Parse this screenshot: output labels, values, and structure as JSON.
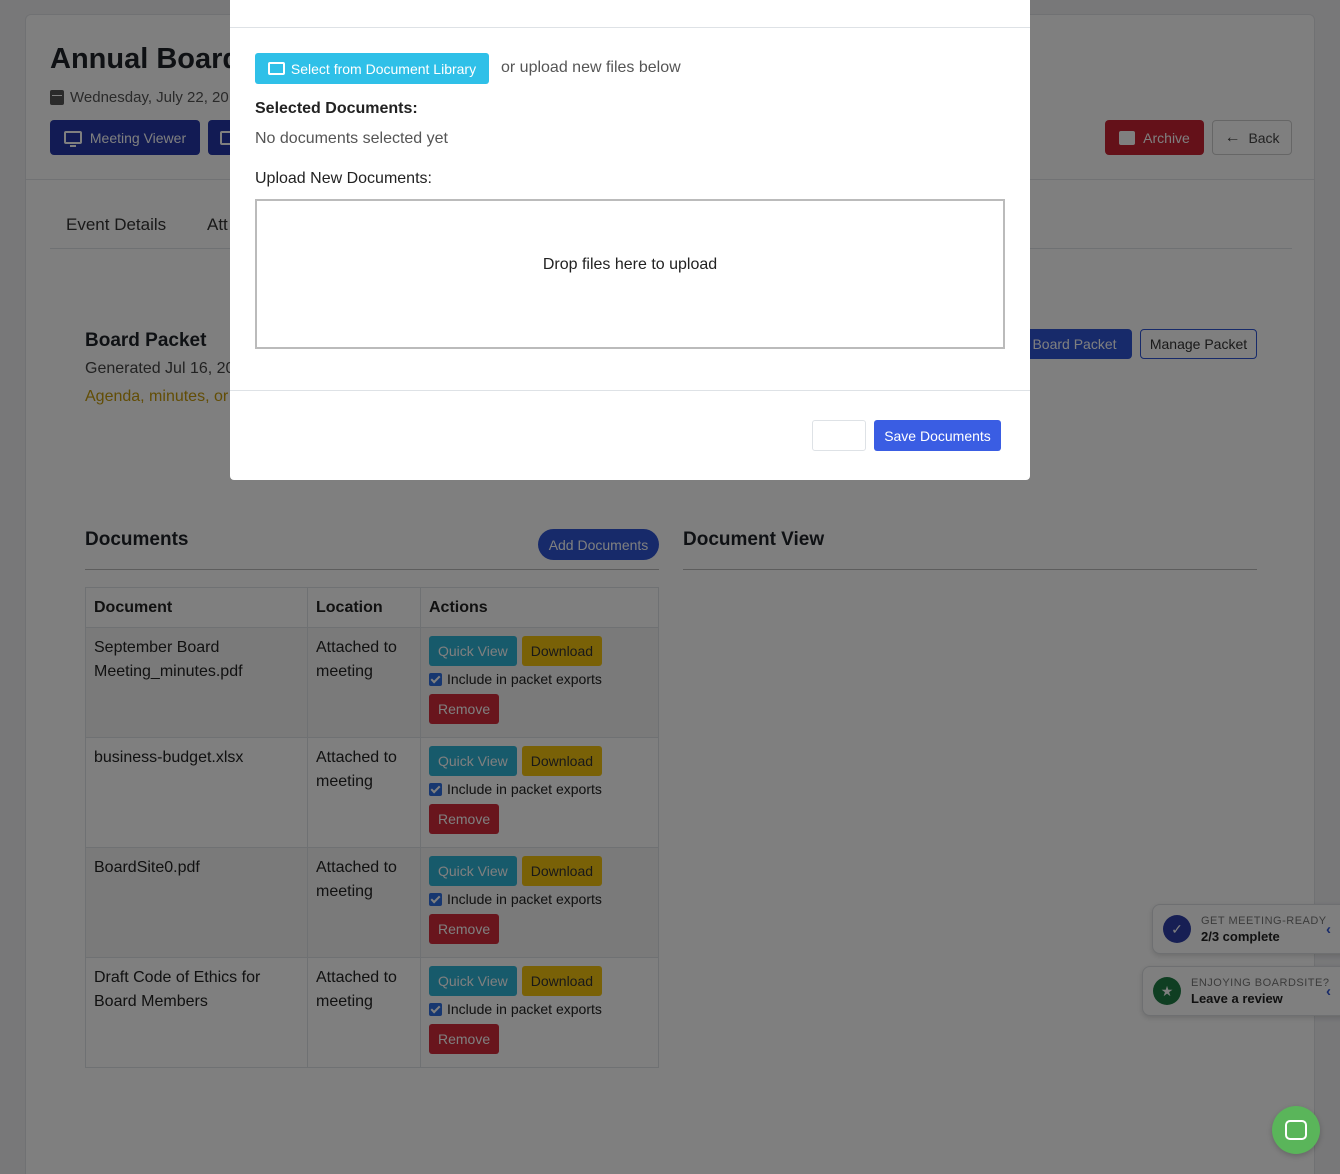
{
  "page": {
    "title": "Annual Board",
    "date": "Wednesday, July 22, 20",
    "buttons": {
      "meeting_viewer": "Meeting Viewer",
      "archive": "Archive",
      "back": "Back"
    },
    "tabs": [
      "Event Details",
      "Att"
    ]
  },
  "packet": {
    "title": "Board Packet",
    "generated": "Generated Jul 16, 20",
    "warning": "Agenda, minutes, or",
    "board_packet_button": "Board Packet",
    "manage_button": "Manage Packet"
  },
  "documents": {
    "title": "Documents",
    "add_button": "Add Documents",
    "view_title": "Document View",
    "columns": [
      "Document",
      "Location",
      "Actions"
    ],
    "rows": [
      {
        "name": "September Board Meeting_minutes.pdf",
        "location": "Attached to meeting"
      },
      {
        "name": "business-budget.xlsx",
        "location": "Attached to meeting"
      },
      {
        "name": "BoardSite0.pdf",
        "location": "Attached to meeting"
      },
      {
        "name": "Draft Code of Ethics for Board Members",
        "location": "Attached to meeting"
      }
    ],
    "actions": {
      "quick_view": "Quick View",
      "download": "Download",
      "include": "Include in packet exports",
      "remove": "Remove"
    }
  },
  "modal": {
    "library_button": "Select from Document Library",
    "or_text": "or upload new files below",
    "selected_label": "Selected Documents:",
    "selected_empty": "No documents selected yet",
    "upload_label": "Upload New Documents:",
    "dropzone_text": "Drop files here to upload",
    "save_button": "Save Documents"
  },
  "widgets": {
    "meeting_ready": {
      "small": "GET MEETING-READY",
      "big": "2/3 complete",
      "color": "#2f3fa8"
    },
    "review": {
      "small": "ENJOYING BOARDSITE?",
      "big": "Leave a review",
      "color": "#1e7d45"
    }
  },
  "colors": {
    "primary": "#2f55d4",
    "archive": "#c82333",
    "info": "#2eb4d6",
    "warning": "#f3c20e"
  }
}
